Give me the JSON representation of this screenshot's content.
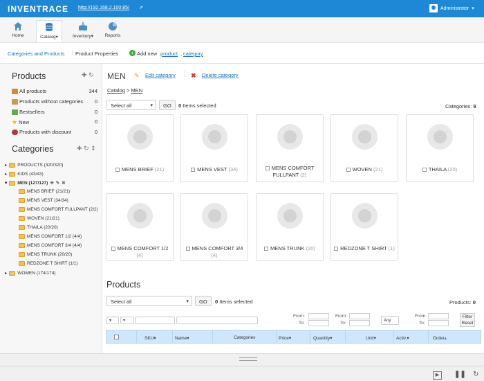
{
  "header": {
    "brand": "INVENTRACE",
    "url": "http://192.168.2.100:85/",
    "user": "Administrator"
  },
  "toolbar": {
    "home": "Home",
    "catalog": "Catalog",
    "inventory": "Inventory",
    "reports": "Reports"
  },
  "subnav": {
    "categories_products": "Categories and Products",
    "product_properties": "Product Properties",
    "add_new": "Add new",
    "product": "product",
    "comma": ",",
    "category": "category"
  },
  "sidebar": {
    "products_title": "Products",
    "products": [
      {
        "label": "All products",
        "count": "344"
      },
      {
        "label": "Products without categories",
        "count": "0"
      },
      {
        "label": "Bestsellers",
        "count": "0"
      },
      {
        "label": "New",
        "count": "0"
      },
      {
        "label": "Products with discount",
        "count": "0"
      }
    ],
    "categories_title": "Categories",
    "tree": [
      {
        "label": "PRODUCTS (320/320)"
      },
      {
        "label": "KIDS (43/43)"
      },
      {
        "label": "MEN (127/127)"
      },
      {
        "label": "MENS BRIEF (21/21)"
      },
      {
        "label": "MENS VEST (34/34)"
      },
      {
        "label": "MENS COMFORT FULLPANT (2/2)"
      },
      {
        "label": "WOVEN (21/21)"
      },
      {
        "label": "THAILA (20/20)"
      },
      {
        "label": "MENS COMFORT 1/2 (4/4)"
      },
      {
        "label": "MENS COMFORT 3/4 (4/4)"
      },
      {
        "label": "MENS TRUNK (20/20)"
      },
      {
        "label": "REDZONE T SHIRT (1/1)"
      },
      {
        "label": "WOMEN (174/174)"
      }
    ]
  },
  "main": {
    "title": "MEN",
    "edit_category": "Edit category",
    "delete_category": "Delete category",
    "crumb_catalog": "Catalog",
    "crumb_sep": ">",
    "crumb_men": "MEN",
    "select_all": "Select all",
    "go": "GO",
    "selected_count": "0",
    "items_selected": "Items selected",
    "categories_label": "Categories:",
    "categories_count": "9",
    "cards": [
      {
        "name": "MENS BRIEF",
        "count": "(21)"
      },
      {
        "name": "MENS VEST",
        "count": "(34)"
      },
      {
        "name": "MENS COMFORT FULLPANT",
        "count": "(2)"
      },
      {
        "name": "WOVEN",
        "count": "(21)"
      },
      {
        "name": "THAILA",
        "count": "(20)"
      },
      {
        "name": "MENS COMFORT 1/2",
        "count": "(4)"
      },
      {
        "name": "MENS COMFORT 3/4",
        "count": "(4)"
      },
      {
        "name": "MENS TRUNK",
        "count": "(20)"
      },
      {
        "name": "REDZONE T SHIRT",
        "count": "(1)"
      }
    ],
    "products_title": "Products",
    "products_label": "Products:",
    "products_count": "0",
    "filter": {
      "from": "From:",
      "to": "To:",
      "any": "Any",
      "filter_btn": "Filter",
      "reset_btn": "Reset"
    },
    "columns": [
      "SKU",
      "Name",
      "Categories",
      "Price",
      "Quantity",
      "Unit",
      "Activ.",
      "Order"
    ]
  }
}
